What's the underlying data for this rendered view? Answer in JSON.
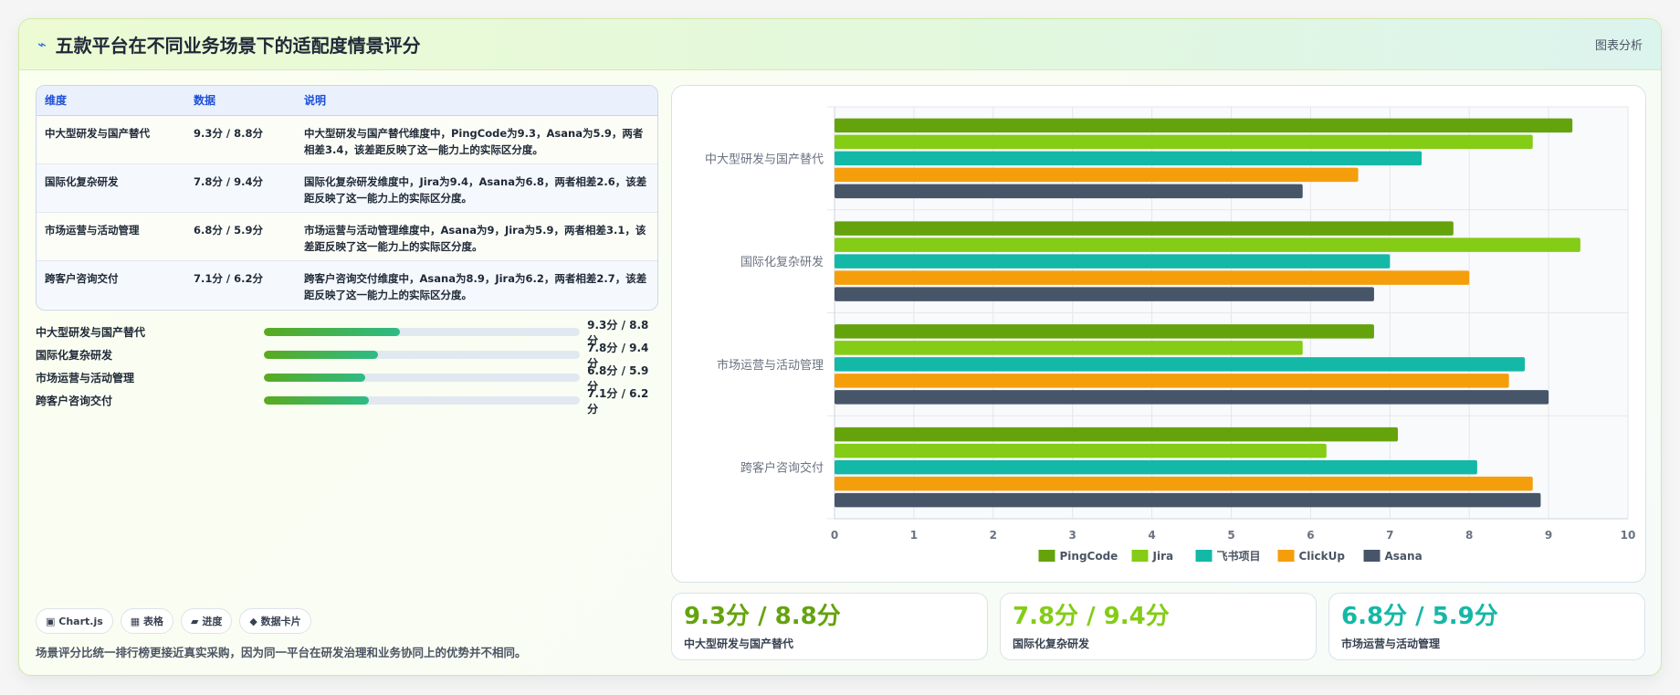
{
  "header": {
    "icon": "bolt-icon",
    "title": "五款平台在不同业务场景下的适配度情景评分",
    "link": "图表分析"
  },
  "table": {
    "headers": [
      "维度",
      "数据",
      "说明"
    ],
    "rows": [
      {
        "dim": "中大型研发与国产替代",
        "data": "9.3分 / 8.8分",
        "desc": "中大型研发与国产替代维度中，PingCode为9.3，Asana为5.9，两者相差3.4，该差距反映了这一能力上的实际区分度。"
      },
      {
        "dim": "国际化复杂研发",
        "data": "7.8分 / 9.4分",
        "desc": "国际化复杂研发维度中，Jira为9.4，Asana为6.8，两者相差2.6，该差距反映了这一能力上的实际区分度。"
      },
      {
        "dim": "市场运营与活动管理",
        "data": "6.8分 / 5.9分",
        "desc": "市场运营与活动管理维度中，Asana为9，Jira为5.9，两者相差3.1，该差距反映了这一能力上的实际区分度。"
      },
      {
        "dim": "跨客户咨询交付",
        "data": "7.1分 / 6.2分",
        "desc": "跨客户咨询交付维度中，Asana为8.9，Jira为6.2，两者相差2.7，该差距反映了这一能力上的实际区分度。"
      }
    ]
  },
  "progress": [
    {
      "label": "中大型研发与国产替代",
      "value": "9.3分 / 8.8分",
      "percent": 43
    },
    {
      "label": "国际化复杂研发",
      "value": "7.8分 / 9.4分",
      "percent": 36
    },
    {
      "label": "市场运营与活动管理",
      "value": "6.8分 / 5.9分",
      "percent": 32
    },
    {
      "label": "跨客户咨询交付",
      "value": "7.1分 / 6.2分",
      "percent": 33
    }
  ],
  "chips": [
    {
      "icon": "▣",
      "label": "Chart.js"
    },
    {
      "icon": "▦",
      "label": "表格"
    },
    {
      "icon": "▰",
      "label": "进度"
    },
    {
      "icon": "◆",
      "label": "数据卡片"
    }
  ],
  "note": "场景评分比统一排行榜更接近真实采购，因为同一平台在研发治理和业务协同上的优势并不相同。",
  "stats": [
    {
      "value": "9.3分 / 8.8分",
      "label": "中大型研发与国产替代",
      "color": "#65a30d"
    },
    {
      "value": "7.8分 / 9.4分",
      "label": "国际化复杂研发",
      "color": "#84cc16"
    },
    {
      "value": "6.8分 / 5.9分",
      "label": "市场运营与活动管理",
      "color": "#14b8a6"
    }
  ],
  "chart_data": {
    "type": "bar",
    "orientation": "horizontal",
    "categories": [
      "中大型研发与国产替代",
      "国际化复杂研发",
      "市场运营与活动管理",
      "跨客户咨询交付"
    ],
    "series": [
      {
        "name": "PingCode",
        "color": "#65a30d",
        "values": [
          9.3,
          7.8,
          6.8,
          7.1
        ]
      },
      {
        "name": "Jira",
        "color": "#84cc16",
        "values": [
          8.8,
          9.4,
          5.9,
          6.2
        ]
      },
      {
        "name": "飞书项目",
        "color": "#14b8a6",
        "values": [
          7.4,
          7.0,
          8.7,
          8.1
        ]
      },
      {
        "name": "ClickUp",
        "color": "#f59e0b",
        "values": [
          6.6,
          8.0,
          8.5,
          8.8
        ]
      },
      {
        "name": "Asana",
        "color": "#475569",
        "values": [
          5.9,
          6.8,
          9.0,
          8.9
        ]
      }
    ],
    "xlim": [
      0,
      10
    ],
    "ticks": [
      "0",
      "1",
      "2",
      "3",
      "4",
      "5",
      "6",
      "7",
      "8",
      "9",
      "10"
    ],
    "grid": true,
    "legend": "bottom"
  }
}
